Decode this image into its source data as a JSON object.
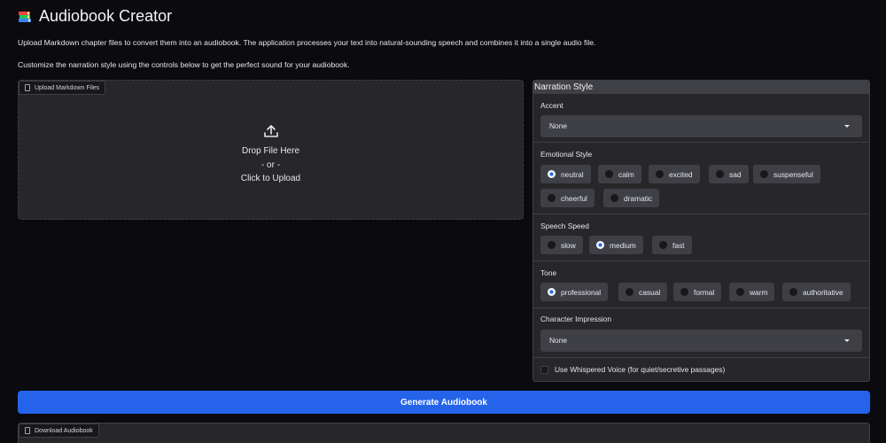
{
  "header": {
    "icon": "books-emoji",
    "title": "Audiobook Creator",
    "description_1": "Upload Markdown chapter files to convert them into an audiobook. The application processes your text into natural-sounding speech and combines it into a single audio file.",
    "description_2": "Customize the narration style using the controls below to get the perfect sound for your audiobook."
  },
  "upload": {
    "label": "Upload Markdown Files",
    "drop_line1": "Drop File Here",
    "drop_line2": "- or -",
    "drop_line3": "Click to Upload"
  },
  "narration": {
    "title": "Narration Style",
    "accent": {
      "label": "Accent",
      "value": "None"
    },
    "emotional_style": {
      "label": "Emotional Style",
      "options": [
        "neutral",
        "calm",
        "excited",
        "sad",
        "suspenseful",
        "cheerful",
        "dramatic"
      ],
      "selected": "neutral"
    },
    "speech_speed": {
      "label": "Speech Speed",
      "options": [
        "slow",
        "medium",
        "fast"
      ],
      "selected": "medium"
    },
    "tone": {
      "label": "Tone",
      "options": [
        "professional",
        "casual",
        "formal",
        "warm",
        "authoritative"
      ],
      "selected": "professional"
    },
    "character_impression": {
      "label": "Character Impression",
      "value": "None"
    },
    "whisper": {
      "label": "Use Whispered Voice (for quiet/secretive passages)",
      "checked": false
    }
  },
  "generate_label": "Generate Audiobook",
  "download": {
    "label": "Download Audiobook"
  },
  "colors": {
    "accent": "#2563eb",
    "background": "#0b0b0f",
    "panel": "#27272a",
    "control": "#3f3f46"
  }
}
